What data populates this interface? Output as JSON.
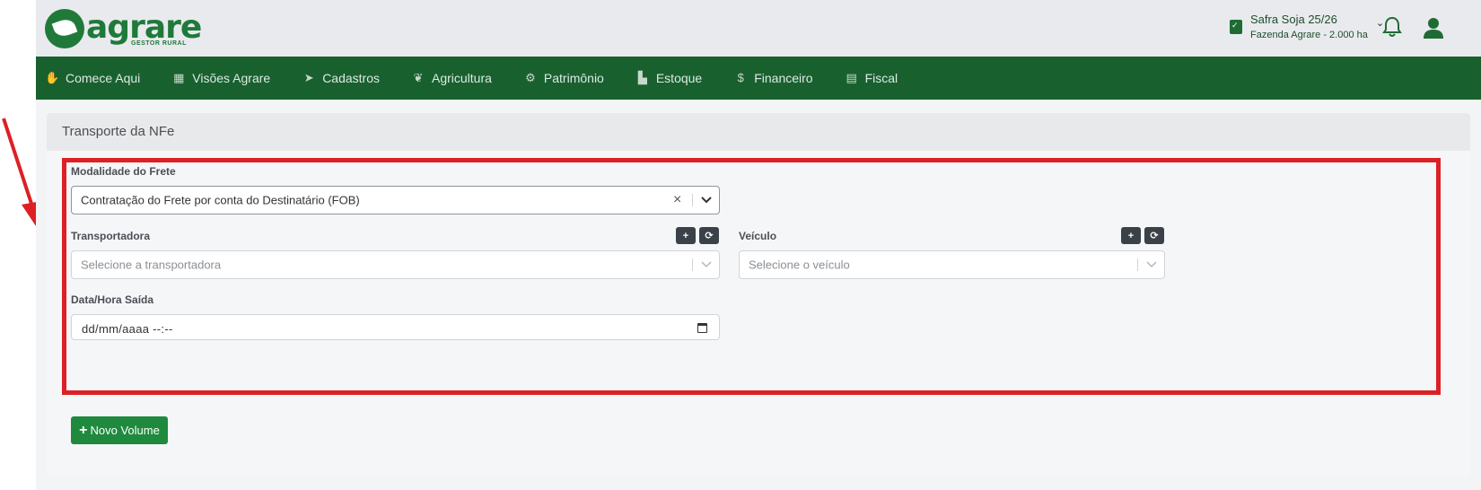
{
  "header": {
    "logo_word": "agrare",
    "logo_sub": "GESTOR RURAL",
    "safra_name": "Safra Soja 25/26",
    "farm_name": "Fazenda Agrare - 2.000 ha"
  },
  "nav": {
    "items": [
      {
        "label": "Comece Aqui",
        "icon": "handshake-icon"
      },
      {
        "label": "Visões Agrare",
        "icon": "dashboard-icon"
      },
      {
        "label": "Cadastros",
        "icon": "truck-icon"
      },
      {
        "label": "Agricultura",
        "icon": "leaf-icon"
      },
      {
        "label": "Patrimônio",
        "icon": "tractor-icon"
      },
      {
        "label": "Estoque",
        "icon": "boxes-icon"
      },
      {
        "label": "Financeiro",
        "icon": "hand-money-icon"
      },
      {
        "label": "Fiscal",
        "icon": "invoice-icon"
      }
    ]
  },
  "card": {
    "title": "Transporte da NFe"
  },
  "form": {
    "modalidade_label": "Modalidade do Frete",
    "modalidade_value": "Contratação do Frete por conta do Destinatário (FOB)",
    "transportadora_label": "Transportadora",
    "transportadora_placeholder": "Selecione a transportadora",
    "veiculo_label": "Veículo",
    "veiculo_placeholder": "Selecione o veículo",
    "data_label": "Data/Hora Saída",
    "data_value": "dd/mm/aaaa --:--",
    "add_glyph": "+",
    "refresh_glyph": "⟳"
  },
  "actions": {
    "novo_volume_label": "Novo Volume"
  },
  "colors": {
    "brand_green": "#1f7a3a",
    "nav_green": "#18612f",
    "highlight_red": "#dc2026",
    "button_green": "#1f8a3d"
  }
}
